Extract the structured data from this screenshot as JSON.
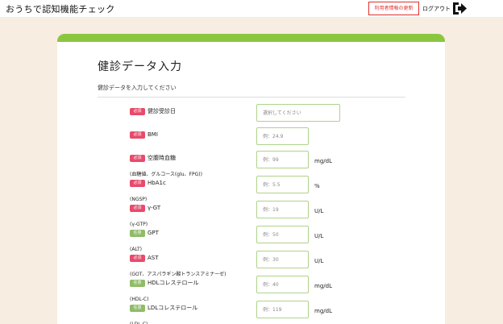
{
  "header": {
    "app_title": "おうちで認知機能チェック",
    "update_button": "利用者情報の更新",
    "logout_label": "ログアウト",
    "logout_icon": "logout-arrow-icon"
  },
  "colors": {
    "accent_green": "#8cc63f",
    "required_badge": "#e84a6b",
    "optional_badge": "#8fbc66",
    "update_red": "#e0302d",
    "background": "#f7ede0"
  },
  "form": {
    "title": "健診データ入力",
    "subtitle": "健診データを入力してください",
    "fields": [
      {
        "badge": "必須",
        "required": true,
        "label": "健診受診日",
        "sub": "",
        "placeholder": "選択してください",
        "unit": ""
      },
      {
        "badge": "必須",
        "required": true,
        "label": "BMI",
        "sub": "",
        "placeholder": "例：24.9",
        "unit": ""
      },
      {
        "badge": "必須",
        "required": true,
        "label": "空腹時血糖",
        "sub": "(血糖値、グルコース(glu、FPG))",
        "placeholder": "例：99",
        "unit": "mg/dL"
      },
      {
        "badge": "必須",
        "required": true,
        "label": "HbA1c",
        "sub": "(NGSP)",
        "placeholder": "例：5.5",
        "unit": "%"
      },
      {
        "badge": "必須",
        "required": true,
        "label": "γ-GT",
        "sub": "(γ-GTP)",
        "placeholder": "例：19",
        "unit": "U/L"
      },
      {
        "badge": "任意",
        "required": false,
        "label": "GPT",
        "sub": "(ALT)",
        "placeholder": "例：50",
        "unit": "U/L"
      },
      {
        "badge": "必須",
        "required": true,
        "label": "AST",
        "sub": "(GOT、アスパラギン酸トランスアミナーゼ)",
        "placeholder": "例：30",
        "unit": "U/L"
      },
      {
        "badge": "任意",
        "required": false,
        "label": "HDLコレステロール",
        "sub": "(HDL-C)",
        "placeholder": "例：40",
        "unit": "mg/dL"
      },
      {
        "badge": "任意",
        "required": false,
        "label": "LDLコレステロール",
        "sub": "(LDL-C)",
        "placeholder": "例：119",
        "unit": "mg/dL"
      }
    ]
  }
}
